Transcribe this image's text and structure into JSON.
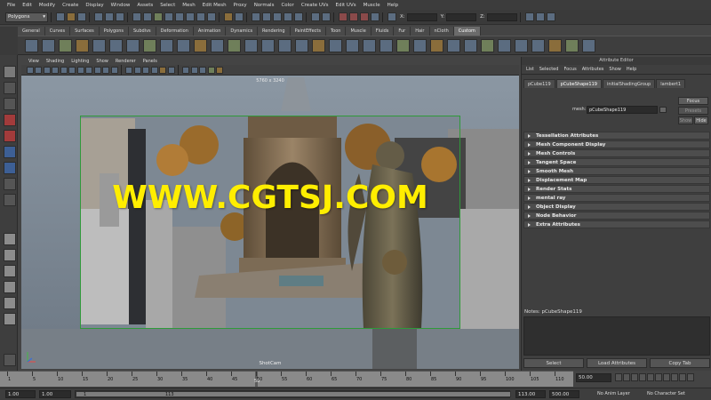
{
  "menubar": [
    "File",
    "Edit",
    "Modify",
    "Create",
    "Display",
    "Window",
    "Assets",
    "Select",
    "Mesh",
    "Edit Mesh",
    "Proxy",
    "Normals",
    "Color",
    "Create UVs",
    "Edit UVs",
    "Muscle",
    "Help"
  ],
  "status": {
    "mode": "Polygons",
    "x_label": "X:",
    "y_label": "Y:",
    "z_label": "Z:"
  },
  "shelf_tabs": [
    "General",
    "Curves",
    "Surfaces",
    "Polygons",
    "Subdivs",
    "Deformation",
    "Animation",
    "Dynamics",
    "Rendering",
    "PaintEffects",
    "Toon",
    "Muscle",
    "Fluids",
    "Fur",
    "Hair",
    "nCloth",
    "Custom"
  ],
  "shelf_active": "Custom",
  "viewport": {
    "menu": [
      "View",
      "Shading",
      "Lighting",
      "Show",
      "Renderer",
      "Panels"
    ],
    "resolution": "5760 x 3240",
    "camera": "ShotCam",
    "watermark": "WWW.CGTSJ.COM"
  },
  "attribute_editor": {
    "title": "Attribute Editor",
    "menu": [
      "List",
      "Selected",
      "Focus",
      "Attributes",
      "Show",
      "Help"
    ],
    "tabs": [
      "pCube119",
      "pCubeShape119",
      "initialShadingGroup",
      "lambert1"
    ],
    "active_tab": "pCubeShape119",
    "mesh_label": "mesh:",
    "mesh_value": "pCubeShape119",
    "focus_button": "Focus",
    "presets_button": "Presets",
    "show_button": "Show",
    "hide_button": "Hide",
    "sections": [
      "Tessellation Attributes",
      "Mesh Component Display",
      "Mesh Controls",
      "Tangent Space",
      "Smooth Mesh",
      "Displacement Map",
      "Render Stats",
      "mental ray",
      "Object Display",
      "Node Behavior",
      "Extra Attributes"
    ],
    "notes_label": "Notes: pCubeShape119",
    "bottom_buttons": [
      "Select",
      "Load Attributes",
      "Copy Tab"
    ]
  },
  "timeline": {
    "ticks": [
      "1",
      "5",
      "10",
      "15",
      "20",
      "25",
      "30",
      "35",
      "40",
      "45",
      "50",
      "55",
      "60",
      "65",
      "70",
      "75",
      "80",
      "85",
      "90",
      "95",
      "100",
      "105",
      "110"
    ],
    "current_marker_label": "50",
    "current_frame": "50.00"
  },
  "range": {
    "start": "1.00",
    "playback_start": "1.00",
    "handle_left": "1",
    "handle_right": "113",
    "playback_end": "113.00",
    "end": "500.00",
    "anim_layer": "No Anim Layer",
    "character_set": "No Character Set"
  }
}
